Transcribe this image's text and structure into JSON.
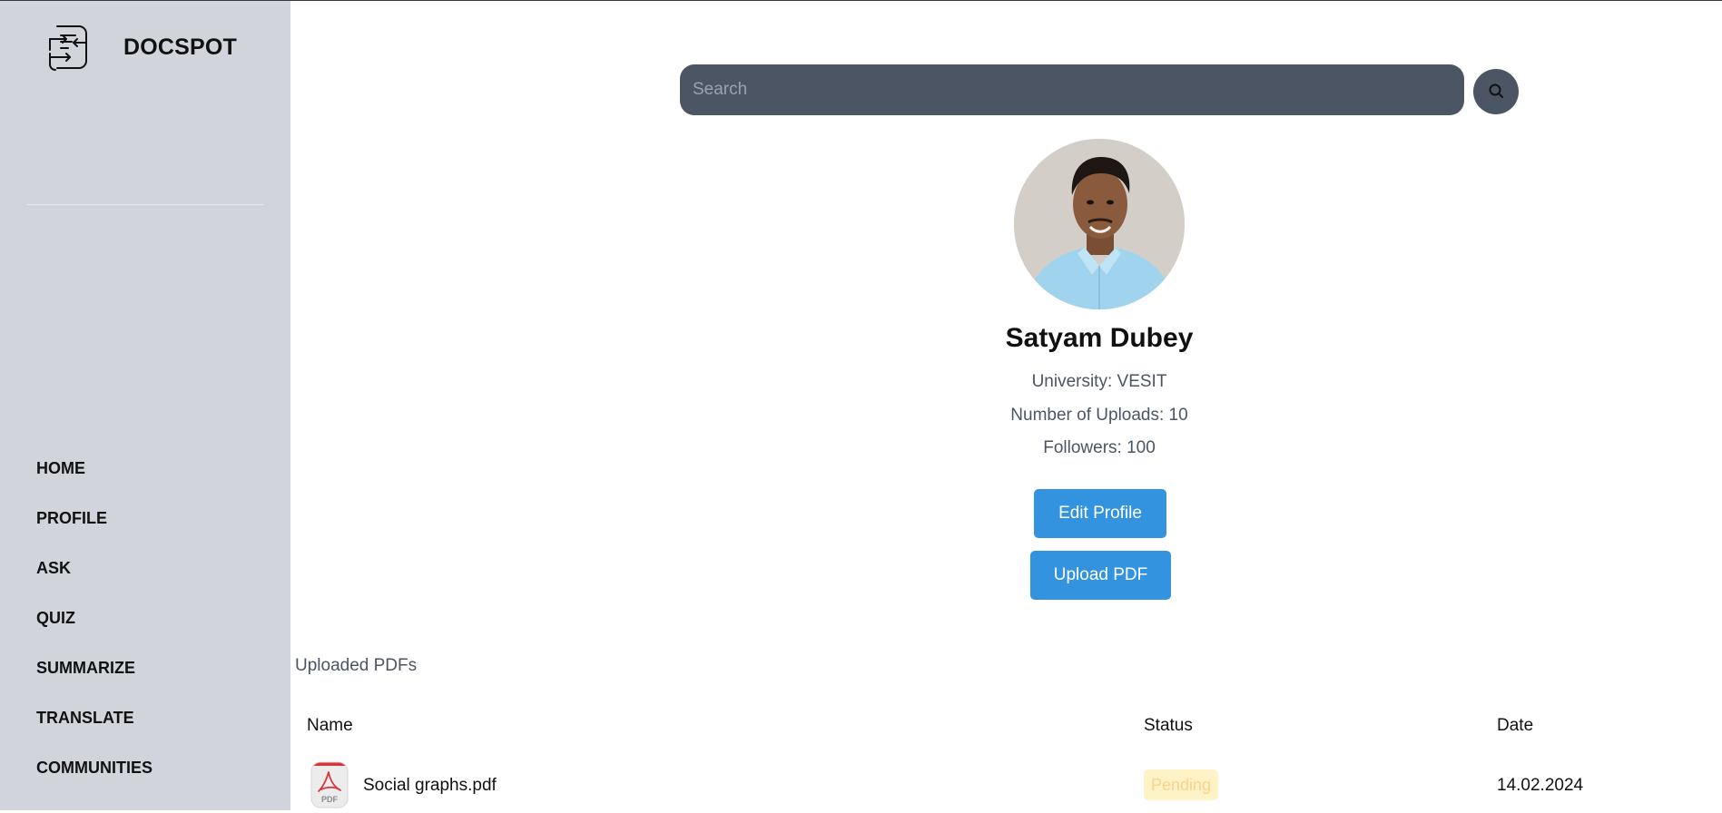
{
  "app": {
    "name": "DOCSPOT"
  },
  "sidebar": {
    "items": [
      {
        "label": "HOME"
      },
      {
        "label": "PROFILE"
      },
      {
        "label": "ASK"
      },
      {
        "label": "QUIZ"
      },
      {
        "label": "SUMMARIZE"
      },
      {
        "label": "TRANSLATE"
      },
      {
        "label": "COMMUNITIES"
      }
    ]
  },
  "search": {
    "placeholder": "Search",
    "value": ""
  },
  "profile": {
    "name": "Satyam Dubey",
    "university": "University: VESIT",
    "uploads": "Number of Uploads: 10",
    "followers": "Followers: 100",
    "edit_label": "Edit Profile",
    "upload_label": "Upload PDF"
  },
  "uploads": {
    "title": "Uploaded PDFs",
    "columns": {
      "name": "Name",
      "status": "Status",
      "date": "Date"
    },
    "rows": [
      {
        "name": "Social graphs.pdf",
        "status": "Pending",
        "date": "14.02.2024",
        "icon": "pdf-file-icon"
      }
    ]
  },
  "icons": {
    "logo": "document-swap-icon",
    "search": "search-icon"
  },
  "colors": {
    "sidebar_bg": "#d1d5db",
    "search_bg": "#4b5563",
    "primary_button": "#3393df",
    "pending_badge_bg": "#fef3c7",
    "pending_badge_text": "#fbd38d"
  }
}
